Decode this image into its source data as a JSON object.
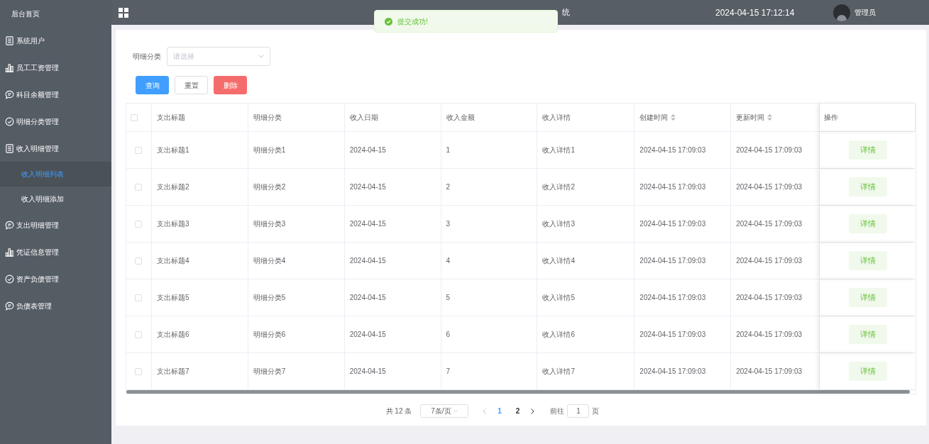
{
  "sidebar": {
    "home": "后台首页",
    "items": [
      {
        "label": "系统用户",
        "kind": "document"
      },
      {
        "label": "员工工资管理",
        "kind": "chart"
      },
      {
        "label": "科目余额管理",
        "kind": "chat"
      },
      {
        "label": "明细分类管理",
        "kind": "check"
      },
      {
        "label": "收入明细管理",
        "kind": "document",
        "children": [
          {
            "label": "收入明细列表",
            "selected": true
          },
          {
            "label": "收入明细添加",
            "selected": false
          }
        ]
      },
      {
        "label": "支出明细管理",
        "kind": "chat"
      },
      {
        "label": "凭证信息管理",
        "kind": "chart"
      },
      {
        "label": "资产负债管理",
        "kind": "check"
      },
      {
        "label": "负债表管理",
        "kind": "chat"
      }
    ]
  },
  "header": {
    "title": "统",
    "datetime": "2024-04-15 17:12:14",
    "user": "管理员"
  },
  "toast": {
    "message": "提交成功!"
  },
  "filter": {
    "label": "明细分类",
    "placeholder": "请选择"
  },
  "buttons": [
    {
      "label": "查询",
      "kind": "primary"
    },
    {
      "label": "重置",
      "kind": "default"
    },
    {
      "label": "删除",
      "kind": "danger"
    }
  ],
  "table": {
    "select_all_checked": false,
    "columns": [
      {
        "label": "支出标题",
        "sortable": false
      },
      {
        "label": "明细分类",
        "sortable": false
      },
      {
        "label": "收入日期",
        "sortable": false
      },
      {
        "label": "收入金额",
        "sortable": false
      },
      {
        "label": "收入详情",
        "sortable": false
      },
      {
        "label": "创建时间",
        "sortable": true
      },
      {
        "label": "更新时间",
        "sortable": true
      },
      {
        "label": "操作",
        "sortable": false
      }
    ],
    "rows": [
      {
        "checked": false,
        "cells": [
          "支出标题1",
          "明细分类1",
          "2024-04-15",
          "1",
          "收入详情1",
          "2024-04-15 17:09:03",
          "2024-04-15 17:09:03"
        ],
        "action": "详情"
      },
      {
        "checked": false,
        "cells": [
          "支出标题2",
          "明细分类2",
          "2024-04-15",
          "2",
          "收入详情2",
          "2024-04-15 17:09:03",
          "2024-04-15 17:09:03"
        ],
        "action": "详情"
      },
      {
        "checked": false,
        "cells": [
          "支出标题3",
          "明细分类3",
          "2024-04-15",
          "3",
          "收入详情3",
          "2024-04-15 17:09:03",
          "2024-04-15 17:09:03"
        ],
        "action": "详情"
      },
      {
        "checked": false,
        "cells": [
          "支出标题4",
          "明细分类4",
          "2024-04-15",
          "4",
          "收入详情4",
          "2024-04-15 17:09:03",
          "2024-04-15 17:09:03"
        ],
        "action": "详情"
      },
      {
        "checked": false,
        "cells": [
          "支出标题5",
          "明细分类5",
          "2024-04-15",
          "5",
          "收入详情5",
          "2024-04-15 17:09:03",
          "2024-04-15 17:09:03"
        ],
        "action": "详情"
      },
      {
        "checked": false,
        "cells": [
          "支出标题6",
          "明细分类6",
          "2024-04-15",
          "6",
          "收入详情6",
          "2024-04-15 17:09:03",
          "2024-04-15 17:09:03"
        ],
        "action": "详情"
      },
      {
        "checked": false,
        "cells": [
          "支出标题7",
          "明细分类7",
          "2024-04-15",
          "7",
          "收入详情7",
          "2024-04-15 17:09:03",
          "2024-04-15 17:09:03"
        ],
        "action": "详情"
      }
    ]
  },
  "pagination": {
    "total": "共 12 条",
    "page_size": "7条/页",
    "pages": [
      {
        "label": "1",
        "selected": true
      },
      {
        "label": "2",
        "selected": false
      }
    ],
    "goto_label": "前往",
    "goto_value": "1",
    "page_suffix": "页"
  }
}
